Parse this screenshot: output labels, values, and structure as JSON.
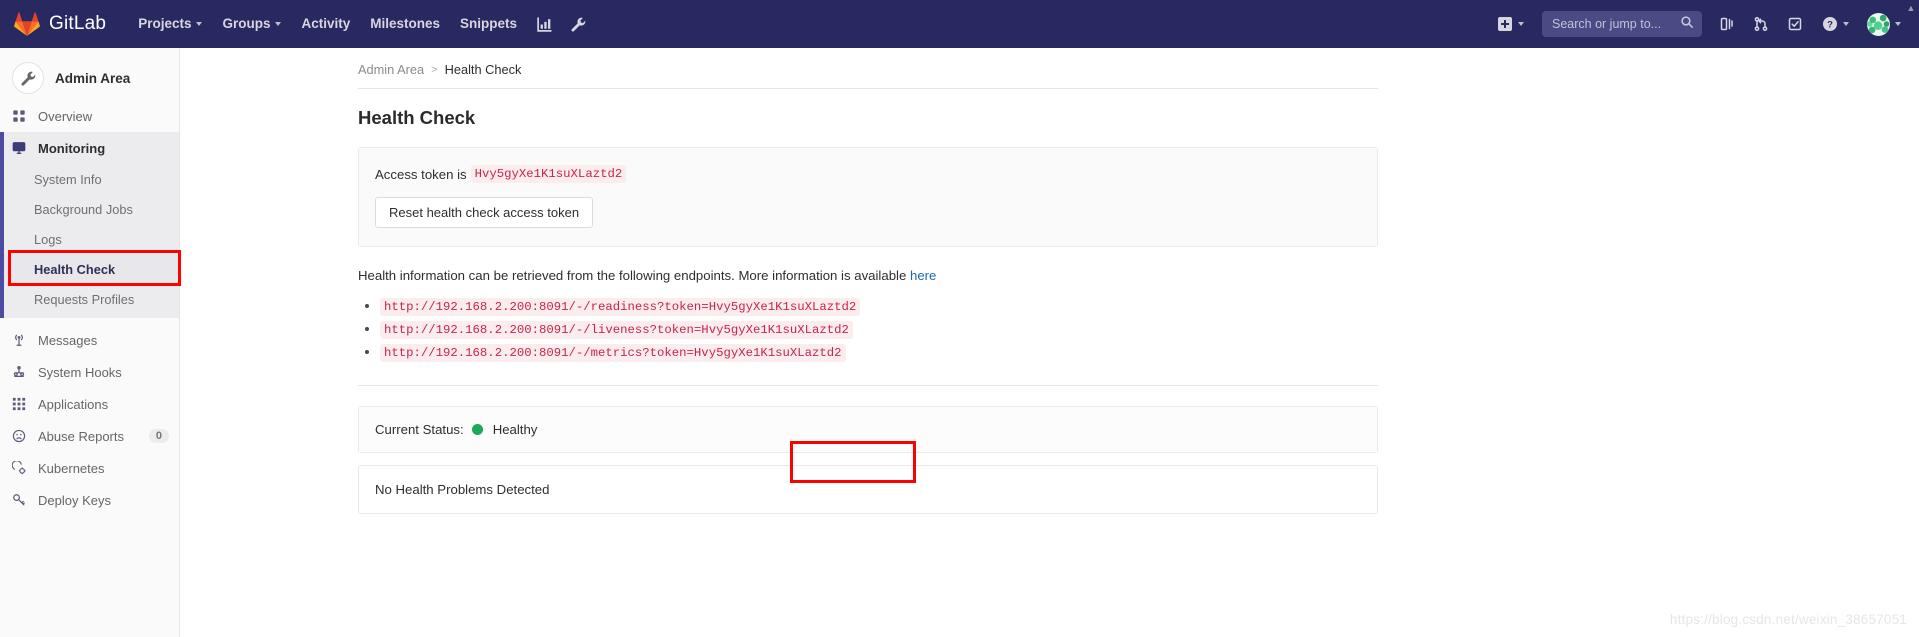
{
  "navbar": {
    "brand": "GitLab",
    "brand_icon": "gitlab-fox-logo",
    "links": [
      {
        "label": "Projects",
        "has_caret": true
      },
      {
        "label": "Groups",
        "has_caret": true
      },
      {
        "label": "Activity",
        "has_caret": false
      },
      {
        "label": "Milestones",
        "has_caret": false
      },
      {
        "label": "Snippets",
        "has_caret": false
      }
    ],
    "icon_buttons": [
      {
        "name": "analytics-chart-icon"
      },
      {
        "name": "wrench-admin-icon"
      }
    ],
    "create_new_label": "",
    "search": {
      "placeholder": "Search or jump to...",
      "value": "",
      "icon": "search-icon"
    },
    "right_icons": [
      {
        "name": "issues-board-icon"
      },
      {
        "name": "merge-request-icon"
      },
      {
        "name": "todos-check-icon"
      },
      {
        "name": "help-question-icon"
      }
    ],
    "avatar_alt": "user-avatar"
  },
  "sidebar": {
    "header": {
      "title": "Admin Area",
      "icon": "wrench-icon"
    },
    "items": [
      {
        "label": "Overview",
        "icon": "grid-icon",
        "active": false
      },
      {
        "label": "Monitoring",
        "icon": "monitor-icon",
        "active": true
      }
    ],
    "monitoring_children": [
      {
        "label": "System Info",
        "active": false
      },
      {
        "label": "Background Jobs",
        "active": false
      },
      {
        "label": "Logs",
        "active": false
      },
      {
        "label": "Health Check",
        "active": true
      },
      {
        "label": "Requests Profiles",
        "active": false
      }
    ],
    "lower_items": [
      {
        "label": "Messages",
        "icon": "broadcast-icon",
        "badge": null
      },
      {
        "label": "System Hooks",
        "icon": "hook-icon",
        "badge": null
      },
      {
        "label": "Applications",
        "icon": "apps-grid-icon",
        "badge": null
      },
      {
        "label": "Abuse Reports",
        "icon": "abuse-face-icon",
        "badge": "0"
      },
      {
        "label": "Kubernetes",
        "icon": "kubernetes-icon",
        "badge": null
      },
      {
        "label": "Deploy Keys",
        "icon": "key-icon",
        "badge": null
      }
    ]
  },
  "breadcrumb": {
    "root": "Admin Area",
    "separator": ">",
    "current": "Health Check"
  },
  "main": {
    "page_title": "Health Check",
    "token_panel": {
      "prefix": "Access token is",
      "token": "Hvy5gyXe1K1suXLaztd2",
      "reset_button": "Reset health check access token"
    },
    "info_text_before": "Health information can be retrieved from the following endpoints. More information is available",
    "info_link": "here",
    "endpoints": [
      "http://192.168.2.200:8091/-/readiness?token=Hvy5gyXe1K1suXLaztd2",
      "http://192.168.2.200:8091/-/liveness?token=Hvy5gyXe1K1suXLaztd2",
      "http://192.168.2.200:8091/-/metrics?token=Hvy5gyXe1K1suXLaztd2"
    ],
    "status": {
      "label": "Current Status:",
      "value": "Healthy",
      "dot_color": "#1aaa55"
    },
    "problems": "No Health Problems Detected"
  },
  "annotations": {
    "highlight_color": "#ff0000",
    "targets": [
      "sidebar-health-check",
      "current-status-value"
    ]
  },
  "watermark": "https://blog.csdn.net/weixin_38657051"
}
